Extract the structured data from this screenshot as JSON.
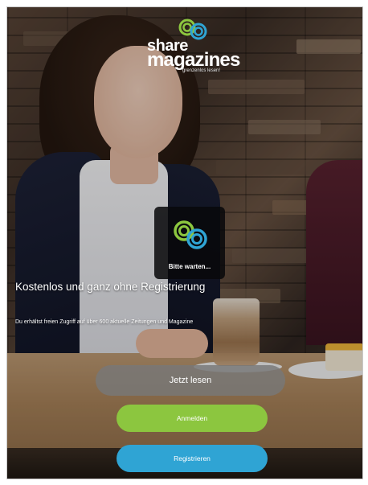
{
  "brand": {
    "name_line1": "share",
    "name_line2": "magazines",
    "tagline": "grenzenlos lesen!",
    "colors": {
      "green": "#8cc63f",
      "blue": "#2fa4d4"
    }
  },
  "loading": {
    "icon": "swirl-spinner-icon",
    "text": "Bitte warten..."
  },
  "hero": {
    "headline": "Kostenlos und ganz ohne Registrierung",
    "subline": "Du erhältst freien Zugriff auf über 600 aktuelle Zeitungen und Magazine"
  },
  "actions": {
    "read_label": "Jetzt lesen",
    "login_label": "Anmelden",
    "register_label": "Registrieren"
  }
}
